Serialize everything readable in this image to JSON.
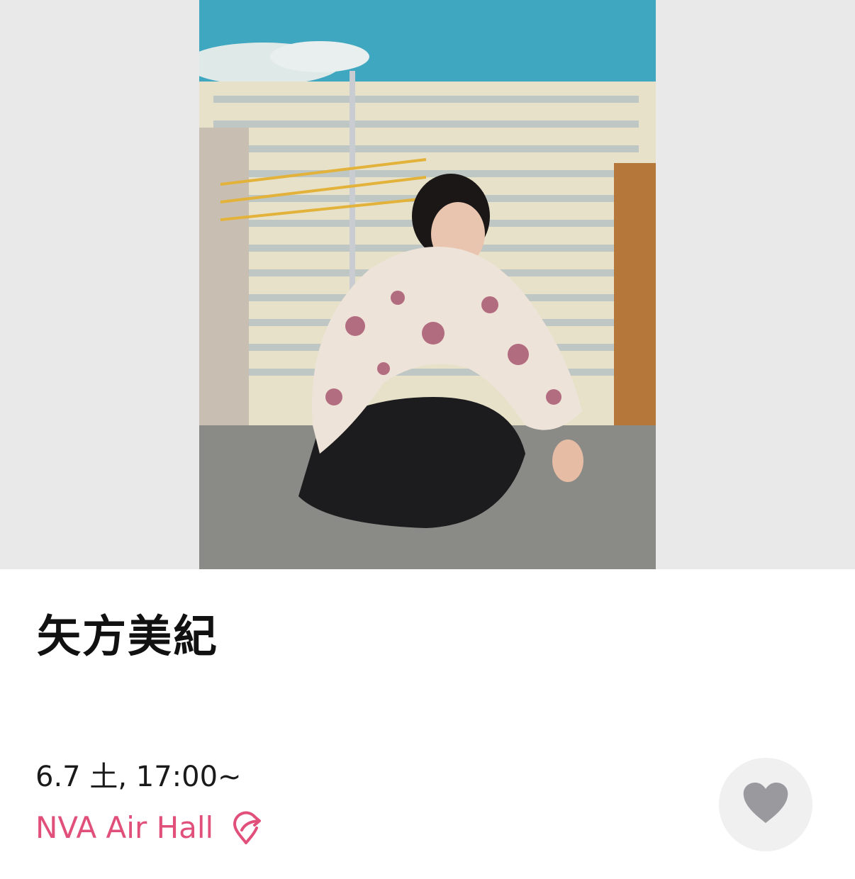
{
  "event": {
    "artist_name": "矢方美紀",
    "datetime": "6.7 土, 17:00~",
    "venue": "NVA Air Hall"
  },
  "icons": {
    "venue": "location-share-icon",
    "favorite": "heart-icon"
  },
  "colors": {
    "accent": "#e0507a",
    "heart": "#9a999e",
    "fav_bg": "#f0f0f1",
    "hero_bg": "#e9e9e9"
  }
}
